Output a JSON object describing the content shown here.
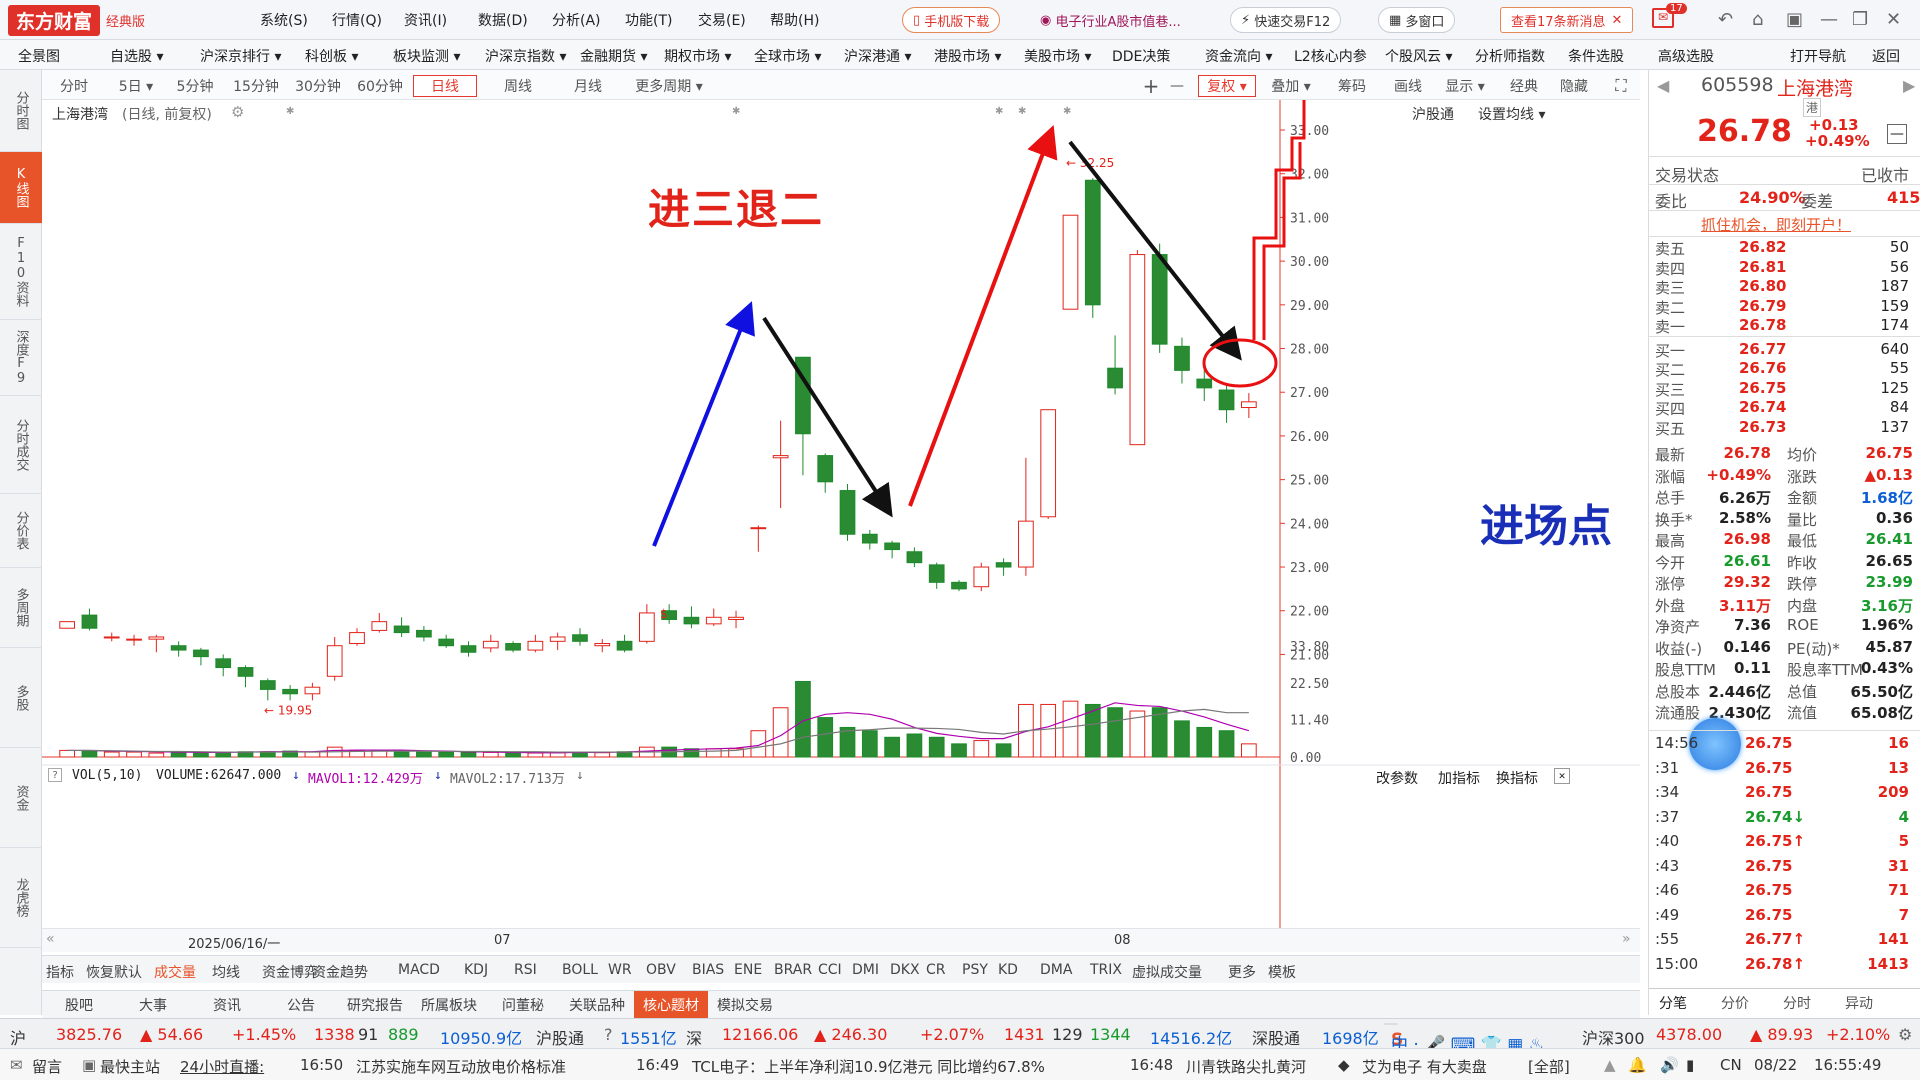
{
  "app": {
    "brand": "东方财富",
    "edition": "经典版"
  },
  "menu": [
    "系统(S)",
    "行情(Q)",
    "资讯(I)",
    "数据(D)",
    "分析(A)",
    "功能(T)",
    "交易(E)",
    "帮助(H)"
  ],
  "toolbar": {
    "mobile": "手机版下载",
    "promo": "电子行业A股市值巷...",
    "quick": "快速交易F12",
    "multi": "多窗口",
    "news": "查看17条新消息",
    "badge": "17"
  },
  "nav": [
    "全景图",
    "自选股 ▾",
    "沪深京排行 ▾",
    "科创板 ▾",
    "板块监测 ▾",
    "沪深京指数 ▾",
    "金融期货 ▾",
    "期权市场 ▾",
    "全球市场 ▾",
    "沪深港通 ▾",
    "港股市场 ▾",
    "美股市场 ▾",
    "DDE决策",
    "资金流向 ▾",
    "L2核心内参",
    "个股风云 ▾",
    "分析师指数",
    "条件选股",
    "高级选股",
    "打开导航",
    "返回"
  ],
  "left_tabs": [
    "分时图",
    "K线图",
    "F10资料",
    "深度F9",
    "分时成交",
    "分价表",
    "多周期",
    "多股",
    "资金",
    "龙虎榜"
  ],
  "periods": [
    "分时",
    "5日 ▾",
    "5分钟",
    "15分钟",
    "30分钟",
    "60分钟",
    "日线",
    "周线",
    "月线",
    "更多周期 ▾"
  ],
  "period_selected": "日线",
  "chart_tools": [
    "+",
    "—",
    "复权 ▾",
    "叠加 ▾",
    "筹码",
    "画线",
    "显示 ▾",
    "经典",
    "隐藏"
  ],
  "chart_header": {
    "name": "上海港湾",
    "mode": "(日线, 前复权)",
    "hgt": "沪股通",
    "ma_set": "设置均线 ▾"
  },
  "annotations": {
    "title": "进三退二",
    "entry": "进场点",
    "high_label": "32.25",
    "low_label": "19.95"
  },
  "vol_header": {
    "name": "VOL(5,10)",
    "volume": "VOLUME:62647.000",
    "mavol1": "MAVOL1:12.429万",
    "mavol2": "MAVOL2:17.713万",
    "btn1": "改参数",
    "btn2": "加指标",
    "btn3": "换指标"
  },
  "dates": {
    "d1": "2025/06/16/一",
    "d2": "07",
    "d3": "08"
  },
  "indicators": [
    "指标",
    "恢复默认",
    "成交量",
    "均线",
    "资金博弈",
    "资金趋势",
    "MACD",
    "KDJ",
    "RSI",
    "BOLL",
    "WR",
    "OBV",
    "BIAS",
    "ENE",
    "BRAR",
    "CCI",
    "DMI",
    "DKX",
    "CR",
    "PSY",
    "KD",
    "DMA",
    "TRIX",
    "虚拟成交量",
    "更多",
    "模板"
  ],
  "info_tabs": [
    "股吧",
    "大事",
    "资讯",
    "公告",
    "研究报告",
    "所属板块",
    "问董秘",
    "关联品种",
    "核心题材",
    "模拟交易"
  ],
  "info_selected": "核心题材",
  "stock": {
    "code": "605598",
    "name": "上海港湾",
    "price": "26.78",
    "change": "+0.13",
    "pct": "+0.49%",
    "tag": "港",
    "status_label": "交易状态",
    "status": "已收市",
    "wb_label": "委比",
    "wb": "24.90%",
    "wc_label": "委差",
    "wc": "415",
    "promo": "抓住机会，即刻开户！"
  },
  "asks": [
    [
      "卖五",
      "26.82",
      "50"
    ],
    [
      "卖四",
      "26.81",
      "56"
    ],
    [
      "卖三",
      "26.80",
      "187"
    ],
    [
      "卖二",
      "26.79",
      "159"
    ],
    [
      "卖一",
      "26.78",
      "174"
    ]
  ],
  "bids": [
    [
      "买一",
      "26.77",
      "640"
    ],
    [
      "买二",
      "26.76",
      "55"
    ],
    [
      "买三",
      "26.75",
      "125"
    ],
    [
      "买四",
      "26.74",
      "84"
    ],
    [
      "买五",
      "26.73",
      "137"
    ]
  ],
  "stats": [
    [
      "最新",
      "26.78",
      "均价",
      "26.75"
    ],
    [
      "涨幅",
      "+0.49%",
      "涨跌",
      "▲0.13"
    ],
    [
      "总手",
      "6.26万",
      "金额",
      "1.68亿"
    ],
    [
      "换手*",
      "2.58%",
      "量比",
      "0.36"
    ],
    [
      "最高",
      "26.98",
      "最低",
      "26.41"
    ],
    [
      "今开",
      "26.61",
      "昨收",
      "26.65"
    ],
    [
      "涨停",
      "29.32",
      "跌停",
      "23.99"
    ],
    [
      "外盘",
      "3.11万",
      "内盘",
      "3.16万"
    ],
    [
      "净资产",
      "7.36",
      "ROE",
      "1.96%"
    ],
    [
      "收益(-)",
      "0.146",
      "PE(动)*",
      "45.87"
    ],
    [
      "股息TTM",
      "0.11",
      "股息率TTM",
      "0.43%"
    ],
    [
      "总股本",
      "2.446亿",
      "总值",
      "65.50亿"
    ],
    [
      "流通股",
      "2.430亿",
      "流值",
      "65.08亿"
    ]
  ],
  "ticks": [
    [
      "14:56",
      "26.75",
      "16"
    ],
    [
      ":31",
      "26.75",
      "13"
    ],
    [
      ":34",
      "26.75",
      "209"
    ],
    [
      ":37",
      "26.74↓",
      "4"
    ],
    [
      ":40",
      "26.75↑",
      "5"
    ],
    [
      ":43",
      "26.75",
      "31"
    ],
    [
      ":46",
      "26.75",
      "71"
    ],
    [
      ":49",
      "26.75",
      "7"
    ],
    [
      ":55",
      "26.77↑",
      "141"
    ],
    [
      "15:00",
      "26.78↑",
      "1413"
    ]
  ],
  "right_tabs": [
    "分笔",
    "分价",
    "分时",
    "异动"
  ],
  "status1": {
    "sh": "沪",
    "sh_val": "3825.76",
    "sh_chg": "▲ 54.66",
    "sh_pct": "+1.45%",
    "sh_up": "1338",
    "sh_flat": "91",
    "sh_dn": "889",
    "sh_amt": "10950.9亿",
    "hgt": "沪股通",
    "hgt_val": "1551亿",
    "sz": "深",
    "sz_val": "12166.06",
    "sz_chg": "▲ 246.30",
    "sz_pct": "+2.07%",
    "sz_up": "1431",
    "sz_flat": "129",
    "sz_dn": "1344",
    "sz_amt": "14516.2亿",
    "sgt": "深股通",
    "sgt_val": "1698亿",
    "hs300": "沪深300",
    "hs300_val": "4378.00",
    "hs300_chg": "▲ 89.93",
    "hs300_pct": "+2.10%"
  },
  "status2": {
    "msg": "留言",
    "main": "最快主站",
    "live": "24小时直播:",
    "n1_time": "16:50",
    "n1": "江苏实施车网互动放电价格标准",
    "n2_time": "16:49",
    "n2": "TCL电子：上半年净利润10.9亿港元 同比增约67.8%",
    "n3_time": "16:48",
    "n3": "川青铁路尖扎黄河",
    "n4": "艾为电子  有大卖盘",
    "all": "[全部]",
    "cn": "CN",
    "date": "08/22",
    "time": "16:55:49"
  },
  "chart_data": {
    "type": "candlestick",
    "y_range": [
      19.5,
      33.0
    ],
    "y_ticks": [
      "33.00",
      "32.00",
      "31.00",
      "30.00",
      "29.00",
      "28.00",
      "27.00",
      "26.00",
      "25.00",
      "24.00",
      "23.00",
      "22.00",
      "21.00"
    ],
    "vol_ticks": [
      "33.80",
      "22.50",
      "11.40",
      "0.00"
    ],
    "candles": [
      [
        21.6,
        21.75,
        21.6,
        21.75,
        2
      ],
      [
        21.9,
        21.6,
        21.55,
        22.05,
        2
      ],
      [
        21.4,
        21.4,
        21.3,
        21.5,
        1.5
      ],
      [
        21.35,
        21.35,
        21.2,
        21.45,
        1.5
      ],
      [
        21.35,
        21.4,
        21.05,
        21.45,
        1.2
      ],
      [
        21.2,
        21.1,
        20.95,
        21.3,
        1.2
      ],
      [
        21.1,
        20.95,
        20.75,
        21.15,
        1.3
      ],
      [
        20.9,
        20.7,
        20.5,
        21.0,
        1.5
      ],
      [
        20.7,
        20.5,
        20.25,
        20.75,
        1.6
      ],
      [
        20.4,
        20.2,
        19.95,
        20.45,
        1.6
      ],
      [
        20.2,
        20.1,
        19.95,
        20.3,
        1.8
      ],
      [
        20.1,
        20.25,
        19.95,
        20.35,
        1.5
      ],
      [
        20.5,
        21.2,
        20.4,
        21.4,
        3
      ],
      [
        21.25,
        21.5,
        21.2,
        21.6,
        2
      ],
      [
        21.55,
        21.75,
        21.5,
        21.95,
        2
      ],
      [
        21.65,
        21.5,
        21.4,
        21.85,
        1.5
      ],
      [
        21.55,
        21.4,
        21.3,
        21.65,
        1.5
      ],
      [
        21.35,
        21.2,
        21.15,
        21.45,
        1.4
      ],
      [
        21.2,
        21.05,
        20.95,
        21.3,
        1.4
      ],
      [
        21.15,
        21.3,
        21.05,
        21.45,
        1.4
      ],
      [
        21.25,
        21.1,
        21.05,
        21.3,
        1.2
      ],
      [
        21.1,
        21.3,
        21.05,
        21.45,
        1.2
      ],
      [
        21.3,
        21.4,
        21.1,
        21.5,
        1.3
      ],
      [
        21.45,
        21.3,
        21.2,
        21.6,
        1.5
      ],
      [
        21.2,
        21.25,
        21.05,
        21.35,
        1.3
      ],
      [
        21.3,
        21.1,
        21.05,
        21.45,
        1.6
      ],
      [
        21.3,
        21.95,
        21.25,
        22.15,
        3
      ],
      [
        22.0,
        21.8,
        21.7,
        22.15,
        3
      ],
      [
        21.85,
        21.7,
        21.6,
        22.1,
        2.5
      ],
      [
        21.7,
        21.85,
        21.65,
        22.05,
        2.5
      ],
      [
        21.8,
        21.85,
        21.6,
        22.0,
        2.5
      ],
      [
        23.9,
        23.9,
        23.35,
        23.95,
        8
      ],
      [
        25.5,
        25.55,
        24.35,
        26.35,
        15
      ],
      [
        27.8,
        26.05,
        25.1,
        27.8,
        23
      ],
      [
        25.55,
        24.95,
        24.7,
        25.6,
        12
      ],
      [
        24.75,
        23.75,
        23.6,
        24.9,
        9
      ],
      [
        23.75,
        23.55,
        23.4,
        23.85,
        8
      ],
      [
        23.55,
        23.4,
        23.2,
        23.6,
        6
      ],
      [
        23.35,
        23.1,
        23.0,
        23.45,
        7
      ],
      [
        23.05,
        22.65,
        22.5,
        23.1,
        6
      ],
      [
        22.65,
        22.5,
        22.45,
        22.7,
        4
      ],
      [
        22.55,
        23.0,
        22.45,
        23.1,
        5
      ],
      [
        23.1,
        23.0,
        22.8,
        23.2,
        4
      ],
      [
        23.0,
        24.05,
        22.8,
        25.5,
        16
      ],
      [
        24.15,
        26.6,
        24.1,
        26.6,
        16
      ],
      [
        28.9,
        31.05,
        28.9,
        31.05,
        17
      ],
      [
        31.85,
        29.0,
        28.7,
        31.9,
        16
      ],
      [
        27.55,
        27.1,
        26.95,
        28.3,
        15
      ],
      [
        25.8,
        30.15,
        25.8,
        30.25,
        14
      ],
      [
        30.15,
        28.1,
        27.9,
        30.4,
        15
      ],
      [
        28.05,
        27.5,
        27.2,
        28.25,
        11
      ],
      [
        27.3,
        27.1,
        26.8,
        27.55,
        9
      ],
      [
        27.05,
        26.6,
        26.3,
        27.2,
        8
      ],
      [
        26.65,
        26.78,
        26.41,
        26.98,
        4
      ]
    ],
    "mavol1": [
      2,
      2,
      1.8,
      1.7,
      1.6,
      1.5,
      1.4,
      1.4,
      1.5,
      1.6,
      1.6,
      1.6,
      2,
      2.1,
      2.1,
      2.1,
      1.9,
      1.8,
      1.6,
      1.5,
      1.4,
      1.3,
      1.3,
      1.4,
      1.4,
      1.5,
      1.8,
      2.1,
      2.3,
      2.5,
      2.7,
      3.5,
      6.5,
      11,
      13,
      13.5,
      13,
      11.5,
      9,
      7.2,
      6.3,
      5.6,
      5.6,
      7.8,
      9.2,
      11.6,
      14,
      16.5,
      15.7,
      15.4,
      14,
      12.2,
      10,
      8
    ],
    "mavol2": [
      2,
      2,
      1.9,
      1.8,
      1.7,
      1.7,
      1.6,
      1.5,
      1.5,
      1.5,
      1.5,
      1.5,
      1.6,
      1.7,
      1.8,
      1.8,
      1.8,
      1.7,
      1.7,
      1.7,
      1.6,
      1.6,
      1.5,
      1.5,
      1.5,
      1.5,
      1.5,
      1.6,
      1.7,
      1.8,
      2,
      3,
      4,
      6,
      7,
      8,
      8.3,
      8.8,
      8.8,
      8.7,
      8.4,
      7.5,
      7,
      8,
      8.5,
      9.2,
      10,
      11,
      12,
      13,
      14,
      14.5,
      13.5,
      13.5
    ]
  }
}
